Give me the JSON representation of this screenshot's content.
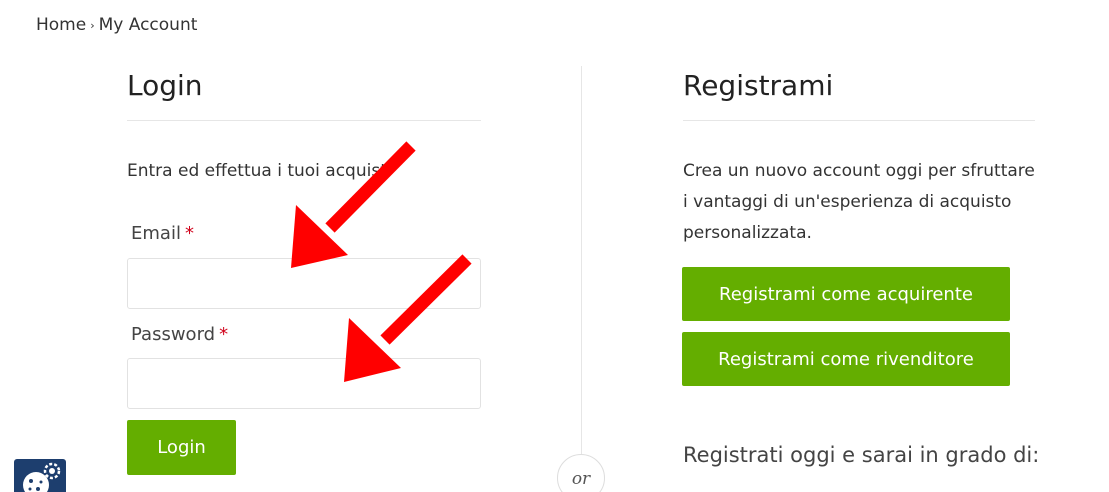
{
  "breadcrumb": {
    "home": "Home",
    "separator": "›",
    "current": "My Account"
  },
  "login": {
    "title": "Login",
    "intro": "Entra ed effettua i tuoi acquisti",
    "email_label": "Email",
    "password_label": "Password",
    "required_mark": "*",
    "email_value": "",
    "password_value": "",
    "submit_label": "Login"
  },
  "divider": {
    "label": "or"
  },
  "register": {
    "title": "Registrami",
    "intro": "Crea un nuovo account oggi per sfruttare i vantaggi di un'esperienza di acquisto personalizzata.",
    "buyer_button": "Registrami come acquirente",
    "reseller_button": "Registrami come rivenditore",
    "benefits_heading": "Registrati oggi e sarai in grado di:"
  },
  "overlay": {
    "arrow_color": "#ff0000",
    "arrows": [
      "pointing-to-email-field",
      "pointing-to-password-field"
    ]
  },
  "colors": {
    "accent": "#64ae00",
    "required": "#d0021b",
    "cookie_badge": "#1d3e6e"
  },
  "icons": {
    "cookie_settings": "cookie-gear-icon"
  }
}
